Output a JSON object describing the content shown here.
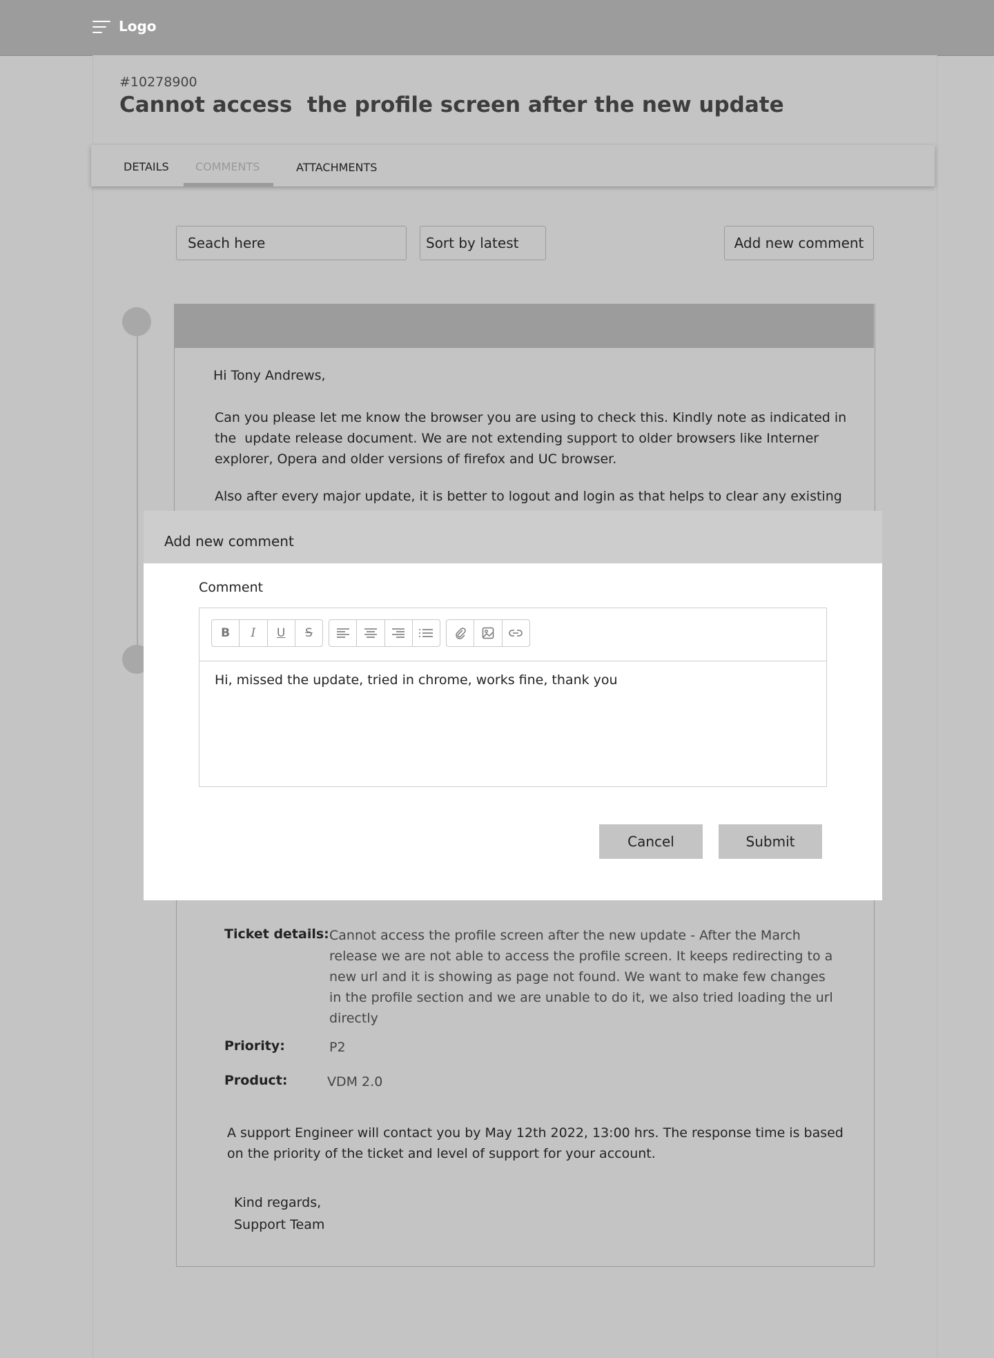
{
  "header": {
    "logo": "Logo",
    "menu_icon": "hamburger-icon"
  },
  "ticket": {
    "id": "#10278900",
    "title": "Cannot access  the profile screen after the new update"
  },
  "tabs": [
    {
      "label": "DETAILS",
      "active": false
    },
    {
      "label": "COMMENTS",
      "active": true
    },
    {
      "label": "ATTACHMENTS",
      "active": false
    }
  ],
  "toolbar": {
    "search_placeholder": "Seach here",
    "sort_value": "Sort by latest",
    "add_comment_label": "Add new comment"
  },
  "comment1": {
    "greeting": "Hi Tony Andrews,",
    "para1_lines": [
      "Can you please let me know the browser you are using to check this. Kindly note as indicated in",
      "the  update release document. We are not extending support to older browsers like Interner",
      "explorer, Opera and older versions of firefox and UC browser."
    ],
    "para2": "Also after every major update, it is better to logout and login as that helps to clear any existing"
  },
  "comment2": {
    "ticket_details_label": "Ticket details:",
    "ticket_details_lines": [
      "Cannot access the profile screen after the new update - After the March",
      "release we are not able to access the profile screen. It keeps redirecting to a",
      "new url and it is showing as page not found. We want to make few changes",
      "in the profile section and we are unable to do it, we also tried loading the url",
      "directly"
    ],
    "priority_label": "Priority:",
    "priority_value": "P2",
    "product_label": "Product:",
    "product_value": "VDM 2.0",
    "support_lines": [
      "A support Engineer will contact you by May 12th 2022, 13:00 hrs. The response time is based",
      "on the priority of the ticket and level of support for your account."
    ],
    "regards": "Kind regards,",
    "team": "Support Team"
  },
  "modal": {
    "title": "Add new comment",
    "comment_label": "Comment",
    "toolbar_groups": [
      [
        "bold-icon",
        "italic-icon",
        "underline-icon",
        "strikethrough-icon"
      ],
      [
        "align-left-icon",
        "align-center-icon",
        "align-right-icon",
        "list-icon"
      ],
      [
        "attachment-icon",
        "image-icon",
        "link-icon"
      ]
    ],
    "comment_text": "Hi, missed the update, tried in chrome, works fine, thank you",
    "cancel_label": "Cancel",
    "submit_label": "Submit"
  }
}
